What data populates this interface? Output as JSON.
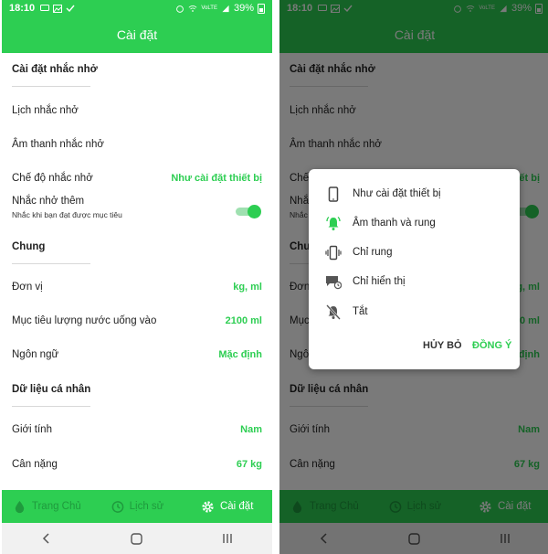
{
  "status_bar": {
    "time": "18:10",
    "battery": "39%",
    "network": "VoLTE"
  },
  "app_bar": {
    "title": "Cài đặt"
  },
  "sections": {
    "reminder": {
      "header": "Cài đặt nhắc nhở",
      "schedule_label": "Lịch nhắc nhở",
      "sound_label": "Âm thanh nhắc nhở",
      "mode_label": "Chế độ nhắc nhở",
      "mode_value": "Như cài đặt thiết bị",
      "extra_label": "Nhắc nhở thêm",
      "extra_sub": "Nhắc khi bạn đạt được mục tiêu",
      "extra_enabled": true
    },
    "general": {
      "header": "Chung",
      "unit_label": "Đơn vị",
      "unit_value": "kg, ml",
      "goal_label": "Mục tiêu lượng nước uống vào",
      "goal_value": "2100 ml",
      "language_label": "Ngôn ngữ",
      "language_value": "Mặc định"
    },
    "personal": {
      "header": "Dữ liệu cá nhân",
      "gender_label": "Giới tính",
      "gender_value": "Nam",
      "weight_label": "Cân nặng",
      "weight_value": "67 kg"
    }
  },
  "bottom_nav": {
    "home": "Trang Chủ",
    "history": "Lịch sử",
    "settings": "Cài đặt"
  },
  "dialog": {
    "options": [
      {
        "label": "Như cài đặt thiết bị",
        "icon": "phone-icon",
        "selected": false
      },
      {
        "label": "Âm thanh và rung",
        "icon": "bell-ring-icon",
        "selected": true
      },
      {
        "label": "Chỉ rung",
        "icon": "vibrate-icon",
        "selected": false
      },
      {
        "label": "Chỉ hiển thị",
        "icon": "message-clock-icon",
        "selected": false
      },
      {
        "label": "Tắt",
        "icon": "bell-off-icon",
        "selected": false
      }
    ],
    "cancel": "HỦY BỎ",
    "confirm": "ĐỒNG Ý"
  },
  "colors": {
    "accent": "#2dce52",
    "nav_inactive": "#1f9a3d",
    "scrim": "#000000"
  }
}
